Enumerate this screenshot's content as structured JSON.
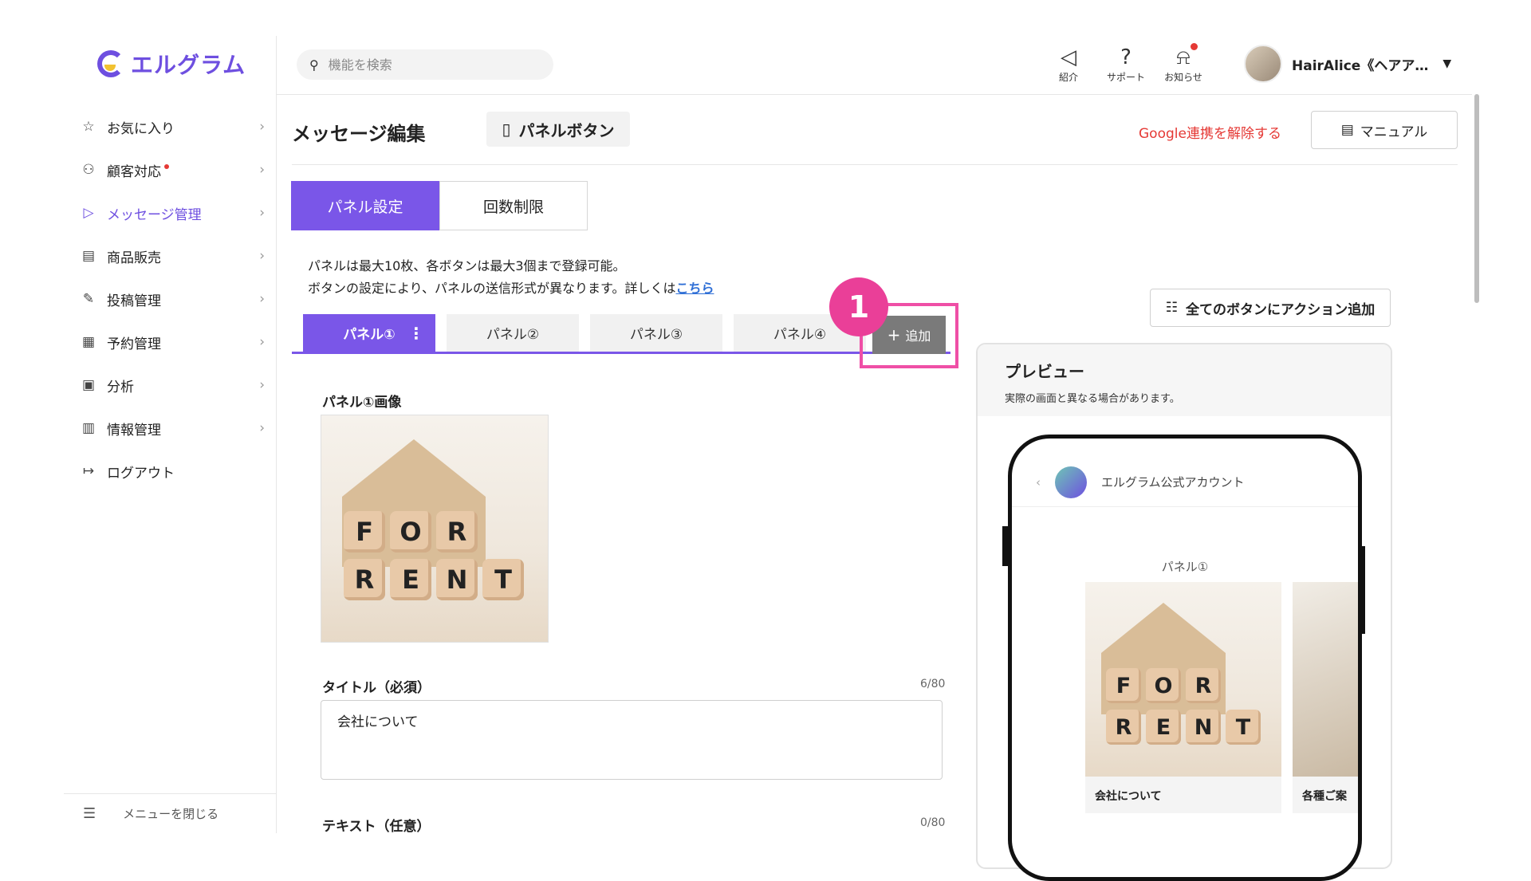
{
  "app": {
    "logo_text": "エルグラム"
  },
  "sidebar": {
    "items": [
      {
        "label": "お気に入り",
        "icon": "star-icon",
        "glyph": "☆"
      },
      {
        "label": "顧客対応",
        "icon": "person-icon",
        "glyph": "⚇",
        "dot": true
      },
      {
        "label": "メッセージ管理",
        "icon": "send-icon",
        "glyph": "▷",
        "active": true
      },
      {
        "label": "商品販売",
        "icon": "register-icon",
        "glyph": "▤"
      },
      {
        "label": "投稿管理",
        "icon": "edit-icon",
        "glyph": "✎"
      },
      {
        "label": "予約管理",
        "icon": "calendar-icon",
        "glyph": "▦"
      },
      {
        "label": "分析",
        "icon": "report-icon",
        "glyph": "▣"
      },
      {
        "label": "情報管理",
        "icon": "bar-chart-icon",
        "glyph": "▥"
      },
      {
        "label": "ログアウト",
        "icon": "logout-icon",
        "glyph": "↦"
      }
    ],
    "close_menu_label": "メニューを閉じる"
  },
  "topbar": {
    "search_placeholder": "機能を検索",
    "icons": [
      {
        "label": "紹介",
        "icon": "megaphone-icon"
      },
      {
        "label": "サポート",
        "icon": "help-icon"
      },
      {
        "label": "お知らせ",
        "icon": "bell-icon"
      }
    ],
    "user_name": "HairAlice《ヘアア…"
  },
  "header": {
    "title": "メッセージ編集",
    "type_label": "パネルボタン",
    "google_link": "Google連携を解除する",
    "manual_label": "マニュアル"
  },
  "mode_tabs": [
    "パネル設定",
    "回数制限"
  ],
  "description": {
    "line1": "パネルは最大10枚、各ボタンは最大3個まで登録可能。",
    "line2": "ボタンの設定により、パネルの送信形式が異なります。詳しくは",
    "link": "こちら"
  },
  "panel_tabs": [
    "パネル①",
    "パネル②",
    "パネル③",
    "パネル④"
  ],
  "add_label": "追加",
  "step_number": "1",
  "form": {
    "image_label": "パネル①画像",
    "title_label": "タイトル（必須）",
    "title_count": "6/80",
    "title_value": "会社について",
    "text_label": "テキスト（任意）",
    "text_count": "0/80",
    "image_letters_top": [
      "F",
      "O",
      "R"
    ],
    "image_letters_bottom": [
      "R",
      "E",
      "N",
      "T"
    ]
  },
  "preview": {
    "bulk_action_label": "全てのボタンにアクション追加",
    "title": "プレビュー",
    "subtitle": "実際の画面と異なる場合があります。",
    "account_name": "エルグラム公式アカウント",
    "panel_label": "パネル①",
    "card1_title": "会社について",
    "card2_title": "各種ご案"
  },
  "colors": {
    "accent": "#7a56e8",
    "highlight": "#ea3f98",
    "danger": "#e53935"
  }
}
